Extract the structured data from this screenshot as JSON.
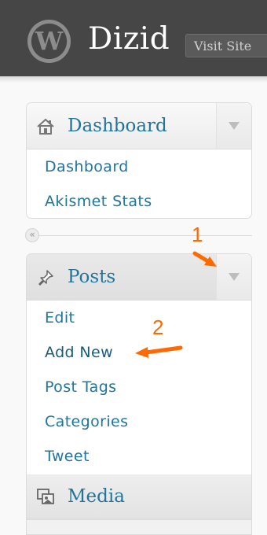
{
  "header": {
    "site_title": "Dizid",
    "visit_site_label": "Visit Site",
    "logo_letter": "W"
  },
  "menu": {
    "dashboard": {
      "label": "Dashboard",
      "items": [
        "Dashboard",
        "Akismet Stats"
      ]
    },
    "collapse_glyph": "«",
    "posts": {
      "label": "Posts",
      "items": [
        "Edit",
        "Add New",
        "Post Tags",
        "Categories",
        "Tweet"
      ]
    },
    "media": {
      "label": "Media"
    }
  },
  "annotations": {
    "marker_1": "1",
    "marker_2": "2",
    "color": "#ff6a00"
  },
  "colors": {
    "link": "#21759b",
    "header_bg": "#464646"
  }
}
